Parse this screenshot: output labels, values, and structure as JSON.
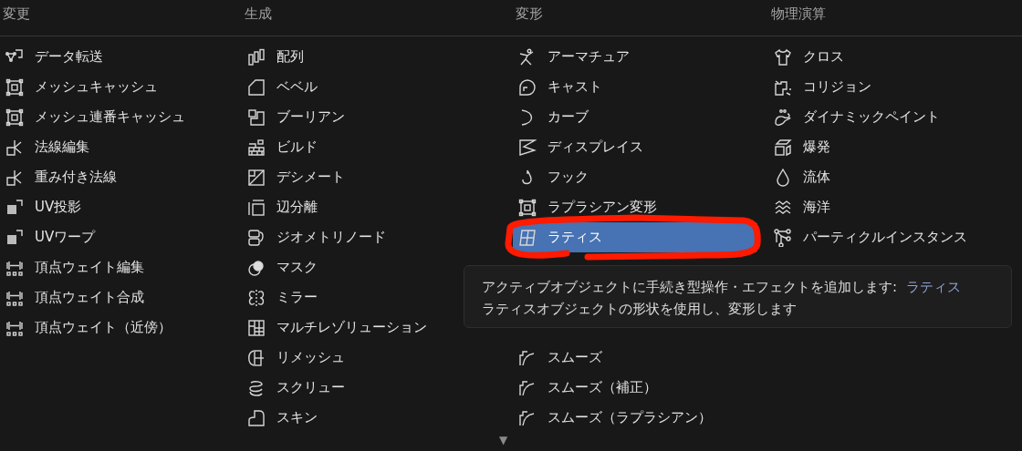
{
  "columns": [
    {
      "title": "変更",
      "items": [
        {
          "label": "データ転送",
          "selected": false
        },
        {
          "label": "メッシュキャッシュ",
          "selected": false
        },
        {
          "label": "メッシュ連番キャッシュ",
          "selected": false
        },
        {
          "label": "法線編集",
          "selected": false
        },
        {
          "label": "重み付き法線",
          "selected": false
        },
        {
          "label": "UV投影",
          "selected": false
        },
        {
          "label": "UVワープ",
          "selected": false
        },
        {
          "label": "頂点ウェイト編集",
          "selected": false
        },
        {
          "label": "頂点ウェイト合成",
          "selected": false
        },
        {
          "label": "頂点ウェイト（近傍）",
          "selected": false
        }
      ]
    },
    {
      "title": "生成",
      "items": [
        {
          "label": "配列",
          "selected": false
        },
        {
          "label": "ベベル",
          "selected": false
        },
        {
          "label": "ブーリアン",
          "selected": false
        },
        {
          "label": "ビルド",
          "selected": false
        },
        {
          "label": "デシメート",
          "selected": false
        },
        {
          "label": "辺分離",
          "selected": false
        },
        {
          "label": "ジオメトリノード",
          "selected": false
        },
        {
          "label": "マスク",
          "selected": false
        },
        {
          "label": "ミラー",
          "selected": false
        },
        {
          "label": "マルチレゾリューション",
          "selected": false
        },
        {
          "label": "リメッシュ",
          "selected": false
        },
        {
          "label": "スクリュー",
          "selected": false
        },
        {
          "label": "スキン",
          "selected": false
        }
      ]
    },
    {
      "title": "変形",
      "items": [
        {
          "label": "アーマチュア",
          "selected": false
        },
        {
          "label": "キャスト",
          "selected": false
        },
        {
          "label": "カーブ",
          "selected": false
        },
        {
          "label": "ディスプレイス",
          "selected": false
        },
        {
          "label": "フック",
          "selected": false
        },
        {
          "label": "ラプラシアン変形",
          "selected": false
        },
        {
          "label": "ラティス",
          "selected": true
        },
        {
          "label": "スムーズ",
          "selected": false,
          "covered_before": true
        },
        {
          "label": "スムーズ（補正）",
          "selected": false
        },
        {
          "label": "スムーズ（ラプラシアン）",
          "selected": false
        }
      ]
    },
    {
      "title": "物理演算",
      "items": [
        {
          "label": "クロス",
          "selected": false
        },
        {
          "label": "コリジョン",
          "selected": false
        },
        {
          "label": "ダイナミックペイント",
          "selected": false
        },
        {
          "label": "爆発",
          "selected": false
        },
        {
          "label": "流体",
          "selected": false
        },
        {
          "label": "海洋",
          "selected": false
        },
        {
          "label": "パーティクルインスタンス",
          "selected": false
        }
      ]
    }
  ],
  "tooltip": {
    "text": "アクティブオブジェクトに手続き型操作・エフェクトを追加します:",
    "name": "ラティス",
    "description": "ラティスオブジェクトの形状を使用し、変形します"
  },
  "annotation": {
    "kind": "ring"
  },
  "scroll_indicator": "▼"
}
